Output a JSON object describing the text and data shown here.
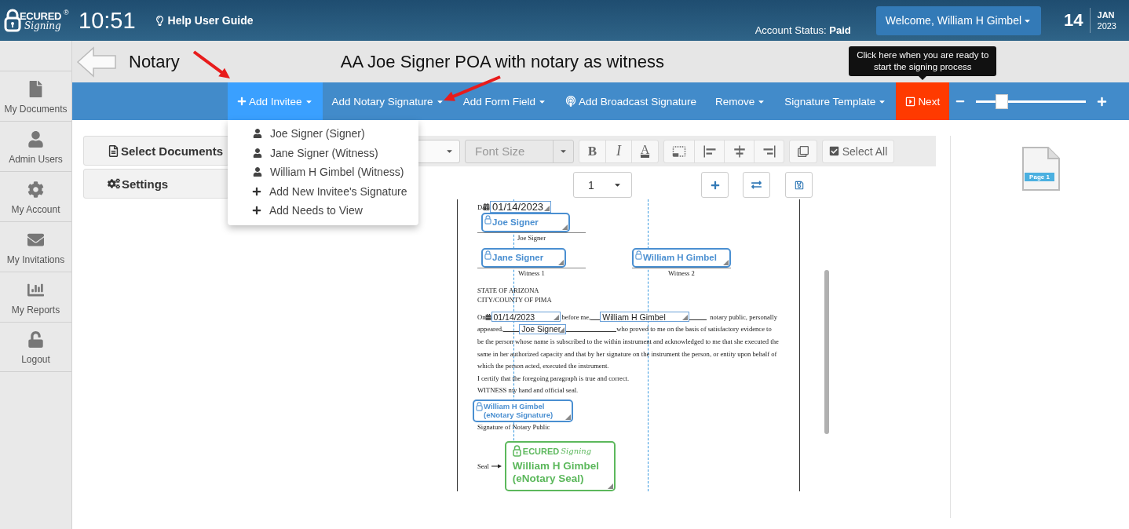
{
  "header": {
    "logo": {
      "wordmark": "ECURED",
      "mark": "®",
      "script": "Signing"
    },
    "time": "10:51",
    "help_link": "Help User Guide",
    "account_status": "Account Status: **Paid**",
    "welcome_button": "Welcome,  William H Gimbel",
    "date": {
      "day": "14",
      "month": "JAN",
      "year": "2023"
    }
  },
  "sidebar": {
    "items": [
      {
        "label": "My Documents"
      },
      {
        "label": "Admin Users"
      },
      {
        "label": "My Account"
      },
      {
        "label": "My Invitations"
      },
      {
        "label": "My Reports"
      },
      {
        "label": "Logout"
      }
    ]
  },
  "page_header": {
    "section": "Notary",
    "document_title": "AA Joe Signer POA with notary as witness"
  },
  "toolbar": {
    "items": [
      {
        "label": "Add Invitee",
        "kind": "addmenu",
        "selected": true
      },
      {
        "label": "Add Notary Signature",
        "kind": "menu",
        "selected": false
      },
      {
        "label": "Add Form Field",
        "kind": "menu",
        "selected": false
      },
      {
        "label": "Add Broadcast Signature",
        "kind": "broadcast",
        "selected": false
      },
      {
        "label": "Remove",
        "kind": "menu",
        "selected": false
      },
      {
        "label": "Signature Template",
        "kind": "menu",
        "selected": false
      },
      {
        "label": "Next",
        "kind": "next",
        "tooltip": "Click here when you are ready to start the signing process"
      }
    ],
    "zoom": {
      "level": 0.2
    }
  },
  "invitee_menu": {
    "items": [
      {
        "label": "Joe Signer (Signer)",
        "kind": "invitee"
      },
      {
        "label": "Jane Signer (Witness)",
        "kind": "invitee"
      },
      {
        "label": "William H Gimbel (Witness)",
        "kind": "invitee"
      },
      {
        "label": "Add New Invitee's Signature",
        "kind": "add"
      },
      {
        "label": "Add Needs to View",
        "kind": "add"
      }
    ]
  },
  "left_panel": {
    "buttons": [
      "Select Documents",
      "Settings"
    ]
  },
  "format_toolbar": {
    "font_size": {
      "placeholder": "Font Size"
    },
    "bold": "B",
    "italic": "I",
    "text_color_button": "A",
    "select_all": "Select All"
  },
  "page_select": {
    "value": "1"
  },
  "document": {
    "date_label": "Da",
    "date_field": "01/14/2023",
    "signer": {
      "field": "Joe Signer",
      "label": "Joe Signer"
    },
    "witnesses": [
      {
        "field": "Jane Signer",
        "label": "Witness 1"
      },
      {
        "field": "William H Gimbel",
        "label": "Witness 2"
      }
    ],
    "venue": [
      "STATE OF ARIZONA",
      "CITY/COUNTY OF PIMA"
    ],
    "acknowledgment": {
      "on": "On",
      "date_field": "01/14/2023",
      "before_me": "before me,",
      "notary_field": "William H Gimbel",
      "after_notary": "notary public, personally",
      "appeared": "appeared,",
      "appeared_field": "Joe Signer",
      "after_appeared": "who proved to me on the basis of satisfactory evidence to"
    },
    "body_lines": [
      "be the person whose name is subscribed to the within instrument and acknowledged to me that she executed the",
      "same in her authorized capacity and that by her signature on the instrument the person, or entity upon behalf of",
      "which the person acted, executed the instrument.",
      "I certify that the foregoing paragraph is true and correct.",
      "WITNESS my hand and official seal."
    ],
    "notary_signature_field": "William H Gimbel (eNotary Signature)",
    "notary_signature_label": "Signature of Notary Public",
    "seal_label": "Seal",
    "seal_field": "William H Gimbel (eNotary Seal)",
    "seal_logo": {
      "wordmark": "ECURED",
      "script": "Signing"
    }
  },
  "thumbnails": [
    {
      "label": "Page 1"
    }
  ]
}
